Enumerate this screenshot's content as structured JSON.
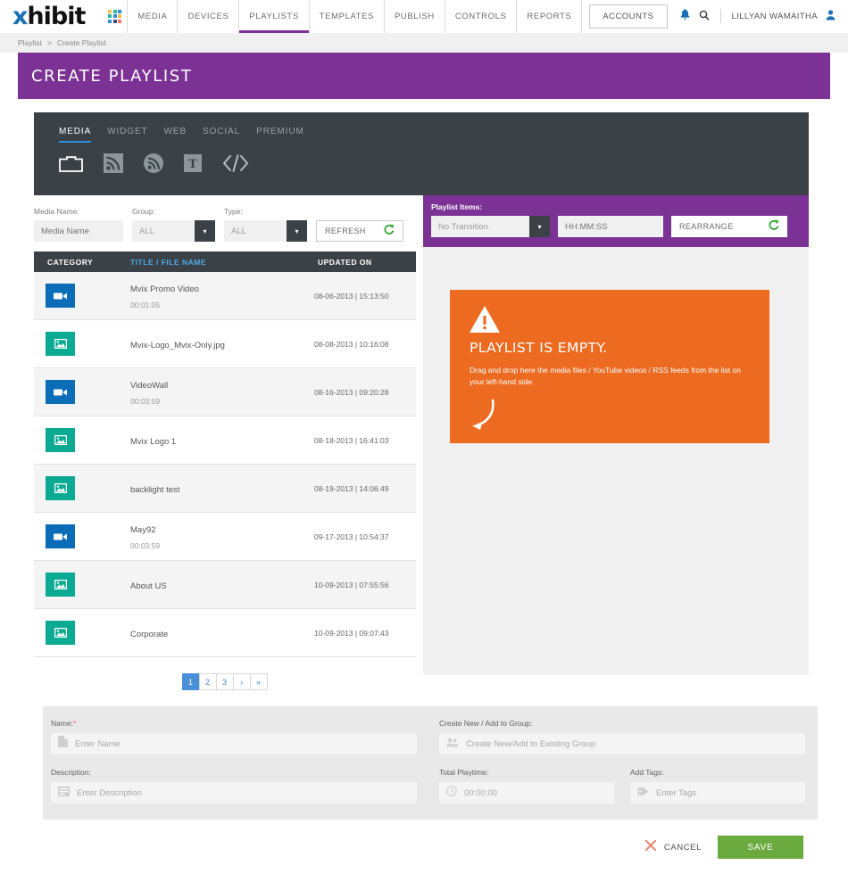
{
  "brand": {
    "logo_x": "x",
    "logo_rest": "hibit"
  },
  "topnav": {
    "grid_icon": "grid-icon",
    "items": [
      {
        "label": "MEDIA",
        "active": false
      },
      {
        "label": "DEVICES",
        "active": false
      },
      {
        "label": "PLAYLISTS",
        "active": true
      },
      {
        "label": "TEMPLATES",
        "active": false
      },
      {
        "label": "PUBLISH",
        "active": false
      },
      {
        "label": "CONTROLS",
        "active": false
      },
      {
        "label": "REPORTS",
        "active": false
      }
    ],
    "accounts_label": "ACCOUNTS",
    "bell_icon": "bell-icon",
    "search_icon": "search-icon",
    "username": "LILLYAN WAMAITHA",
    "user_icon": "user-icon"
  },
  "breadcrumb": {
    "parent": "Playlist",
    "separator": ">",
    "current": "Create Playlist"
  },
  "page_title": "CREATE  PLAYLIST",
  "source_tabs": [
    {
      "label": "MEDIA",
      "active": true
    },
    {
      "label": "WIDGET",
      "active": false
    },
    {
      "label": "WEB",
      "active": false
    },
    {
      "label": "SOCIAL",
      "active": false
    },
    {
      "label": "PREMIUM",
      "active": false
    }
  ],
  "source_icons": [
    {
      "name": "folder-icon"
    },
    {
      "name": "rss-square-icon"
    },
    {
      "name": "rss-circle-icon"
    },
    {
      "name": "text-icon"
    },
    {
      "name": "code-icon"
    }
  ],
  "filters": {
    "media_name_label": "Media Name:",
    "media_name_placeholder": "Media Name",
    "media_name_value": "",
    "group_label": "Group:",
    "group_value": "ALL",
    "type_label": "Type:",
    "type_value": "ALL",
    "refresh_label": "REFRESH",
    "refresh_icon": "refresh-icon"
  },
  "media_table": {
    "headers": {
      "category": "CATEGORY",
      "title": "TITLE / FILE NAME",
      "updated": "UPDATED ON"
    },
    "rows": [
      {
        "kind": "video",
        "icon": "video-icon",
        "title": "Mvix Promo Video",
        "duration": "00:01:05",
        "updated": "08-06-2013 | 15:13:50"
      },
      {
        "kind": "image",
        "icon": "image-icon",
        "title": "Mvix-Logo_Mvix-Only.jpg",
        "duration": "",
        "updated": "08-08-2013 | 10:16:08"
      },
      {
        "kind": "video",
        "icon": "video-icon",
        "title": "VideoWall",
        "duration": "00:03:59",
        "updated": "08-16-2013 | 09:20:28"
      },
      {
        "kind": "image",
        "icon": "image-icon",
        "title": "Mvix Logo 1",
        "duration": "",
        "updated": "08-18-2013 | 16:41:03"
      },
      {
        "kind": "image",
        "icon": "image-icon",
        "title": "backlight test",
        "duration": "",
        "updated": "08-19-2013 | 14:06:49"
      },
      {
        "kind": "video",
        "icon": "video-icon",
        "title": "May92",
        "duration": "00:03:59",
        "updated": "09-17-2013 | 10:54:37"
      },
      {
        "kind": "image",
        "icon": "image-icon",
        "title": "About US",
        "duration": "",
        "updated": "10-09-2013 | 07:55:56"
      },
      {
        "kind": "image",
        "icon": "image-icon",
        "title": "Corporate",
        "duration": "",
        "updated": "10-09-2013 | 09:07:43"
      }
    ]
  },
  "pagination": {
    "pages": [
      {
        "label": "1",
        "active": true
      },
      {
        "label": "2",
        "active": false
      },
      {
        "label": "3",
        "active": false
      },
      {
        "label": "›",
        "active": false
      },
      {
        "label": "»",
        "active": false
      }
    ]
  },
  "playlist_items": {
    "label": "Playlist Items:",
    "transition_value": "No Transition",
    "duration_placeholder": "HH:MM:SS",
    "duration_value": "",
    "rearrange_label": "REARRANGE",
    "rearrange_icon": "refresh-icon"
  },
  "empty_state": {
    "warning_icon": "warning-triangle-icon",
    "title": "PLAYLIST IS EMPTY.",
    "description": "Drag and drop here the media files / YouTube videos / RSS feeds from the list on your left-hand side.",
    "arrow_icon": "curved-arrow-icon",
    "bg_color": "#ec6b21"
  },
  "form": {
    "name_label": "Name:",
    "name_required": "*",
    "name_placeholder": "Enter Name",
    "name_value": "",
    "name_icon": "document-icon",
    "description_label": "Description:",
    "description_placeholder": "Enter Description",
    "description_value": "",
    "description_icon": "lines-icon",
    "group_label": "Create New / Add to Group:",
    "group_placeholder": "Create New/Add to Existing Group",
    "group_value": "",
    "group_icon": "users-icon",
    "playtime_label": "Total Playtime:",
    "playtime_value": "00:00:00",
    "playtime_icon": "clock-icon",
    "tags_label": "Add Tags:",
    "tags_placeholder": "Enter Tags",
    "tags_value": "",
    "tags_icon": "tag-icon"
  },
  "actions": {
    "cancel_label": "CANCEL",
    "cancel_icon": "close-x-icon",
    "save_label": "SAVE",
    "save_color": "#6aaa3e"
  },
  "colors": {
    "purple": "#7b3294",
    "dark": "#3b4247",
    "blue": "#0b6cb8",
    "teal": "#0aab92",
    "orange": "#ec6b21",
    "green": "#6aaa3e",
    "link_blue": "#4a90d9"
  }
}
